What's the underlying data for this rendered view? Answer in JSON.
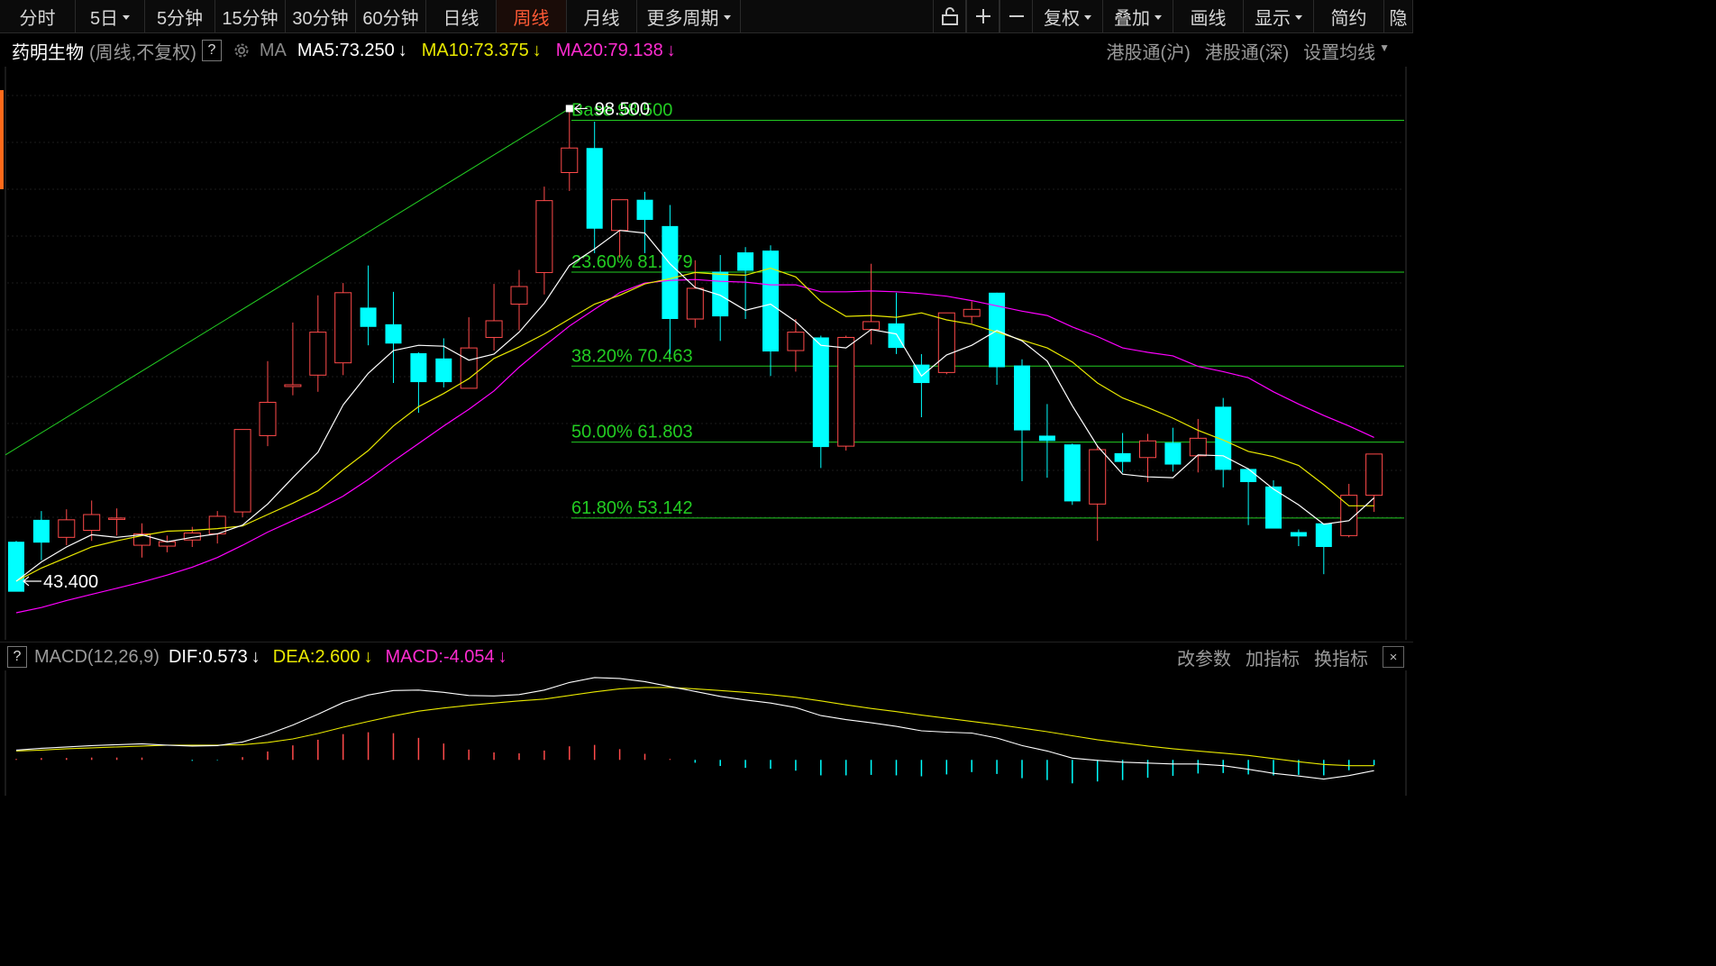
{
  "toolbar": {
    "periods": [
      {
        "label": "分时",
        "dropdown": false,
        "active": false
      },
      {
        "label": "5日",
        "dropdown": true,
        "active": false
      },
      {
        "label": "5分钟",
        "dropdown": false,
        "active": false
      },
      {
        "label": "15分钟",
        "dropdown": false,
        "active": false
      },
      {
        "label": "30分钟",
        "dropdown": false,
        "active": false
      },
      {
        "label": "60分钟",
        "dropdown": false,
        "active": false
      },
      {
        "label": "日线",
        "dropdown": false,
        "active": false
      },
      {
        "label": "周线",
        "dropdown": false,
        "active": true
      },
      {
        "label": "月线",
        "dropdown": false,
        "active": false
      },
      {
        "label": "更多周期",
        "dropdown": true,
        "active": false
      }
    ],
    "right_tools": [
      {
        "label": "复权",
        "dropdown": true
      },
      {
        "label": "叠加",
        "dropdown": true
      },
      {
        "label": "画线",
        "dropdown": false
      },
      {
        "label": "显示",
        "dropdown": true
      },
      {
        "label": "简约",
        "dropdown": false
      },
      {
        "label": "隐",
        "dropdown": false
      }
    ]
  },
  "info": {
    "stock_name": "药明生物",
    "mode": "(周线,不复权)",
    "help": "?",
    "ma_label": "MA",
    "ma5": "MA5:73.250",
    "ma10": "MA10:73.375",
    "ma20": "MA20:79.138",
    "right_links": [
      "港股通(沪)",
      "港股通(深)",
      "设置均线"
    ]
  },
  "colors": {
    "up": "#ff4a4a",
    "down": "#00ffff",
    "ma5": "#ffffff",
    "ma10": "#e8e800",
    "ma20": "#ff00ff",
    "fib": "#22cc22",
    "active_tab": "#ff5a36"
  },
  "chart_data": {
    "type": "candlestick",
    "period": "weekly",
    "ylim": [
      41,
      100.5
    ],
    "high_label": "98.500",
    "low_label": "43.400",
    "fib_levels": [
      {
        "label": "Base   98.500",
        "value": 98.5
      },
      {
        "label": "23.60% 81.179",
        "value": 81.179
      },
      {
        "label": "38.20% 70.463",
        "value": 70.463
      },
      {
        "label": "50.00% 61.803",
        "value": 61.803
      },
      {
        "label": "61.80% 53.142",
        "value": 53.142
      }
    ],
    "candles": [
      [
        49.1,
        43.4,
        49.2,
        44.6
      ],
      [
        51.6,
        49.0,
        52.6,
        47.0
      ],
      [
        49.6,
        51.6,
        52.8,
        48.7
      ],
      [
        50.4,
        52.2,
        53.8,
        49.2
      ],
      [
        51.7,
        51.8,
        52.9,
        49.8
      ],
      [
        48.7,
        50.0,
        51.2,
        47.3
      ],
      [
        48.6,
        49.1,
        49.8,
        47.9
      ],
      [
        49.3,
        50.1,
        50.8,
        48.5
      ],
      [
        50.0,
        52.0,
        52.6,
        48.9
      ],
      [
        52.5,
        61.9,
        61.9,
        51.9
      ],
      [
        61.2,
        65.0,
        69.7,
        60.0
      ],
      [
        66.8,
        67.0,
        74.1,
        65.8
      ],
      [
        68.1,
        73.0,
        77.2,
        66.2
      ],
      [
        69.5,
        77.5,
        78.6,
        68.1
      ],
      [
        75.8,
        73.6,
        80.6,
        71.5
      ],
      [
        73.9,
        71.7,
        77.6,
        67.2
      ],
      [
        70.6,
        67.3,
        70.7,
        63.8
      ],
      [
        70.0,
        67.3,
        72.3,
        66.7
      ],
      [
        66.6,
        71.2,
        74.7,
        66.6
      ],
      [
        72.4,
        74.3,
        78.5,
        70.9
      ],
      [
        76.2,
        78.2,
        80.1,
        73.2
      ],
      [
        79.8,
        88.0,
        89.6,
        77.3
      ],
      [
        91.2,
        94.0,
        98.5,
        89.1
      ],
      [
        94.0,
        84.8,
        97.0,
        82.0
      ],
      [
        84.6,
        88.1,
        88.1,
        81.5
      ],
      [
        88.1,
        85.8,
        89.0,
        82.0
      ],
      [
        85.1,
        74.5,
        87.5,
        70.5
      ],
      [
        74.5,
        78.0,
        81.2,
        73.5
      ],
      [
        79.9,
        74.8,
        81.8,
        72.0
      ],
      [
        82.1,
        80.0,
        82.7,
        74.5
      ],
      [
        82.3,
        70.8,
        82.9,
        68.0
      ],
      [
        70.9,
        73.0,
        74.5,
        68.5
      ],
      [
        72.4,
        59.9,
        72.6,
        57.5
      ],
      [
        60.0,
        72.4,
        72.6,
        59.5
      ],
      [
        73.3,
        74.2,
        80.8,
        71.6
      ],
      [
        74.0,
        71.2,
        77.5,
        70.5
      ],
      [
        69.3,
        67.2,
        70.5,
        63.3
      ],
      [
        68.4,
        75.2,
        75.2,
        68.2
      ],
      [
        74.8,
        75.6,
        76.5,
        74.0
      ],
      [
        77.5,
        69.0,
        77.5,
        67.0
      ],
      [
        69.2,
        61.8,
        69.9,
        56.0
      ],
      [
        61.2,
        60.6,
        64.8,
        56.4
      ],
      [
        60.2,
        53.7,
        60.3,
        53.3
      ],
      [
        53.4,
        59.6,
        60.1,
        49.2
      ],
      [
        59.2,
        58.2,
        61.5,
        57.0
      ],
      [
        58.7,
        60.6,
        61.4,
        55.9
      ],
      [
        60.4,
        57.9,
        62.1,
        57.1
      ],
      [
        58.9,
        60.9,
        63.1,
        57.0
      ],
      [
        64.5,
        57.3,
        65.5,
        55.3
      ],
      [
        57.4,
        55.9,
        57.5,
        51.0
      ],
      [
        55.4,
        50.6,
        56.1,
        50.7
      ],
      [
        50.2,
        49.7,
        50.5,
        48.6
      ],
      [
        51.2,
        48.5,
        51.1,
        45.4
      ],
      [
        49.8,
        54.4,
        55.7,
        49.6
      ],
      [
        54.4,
        59.1,
        59.1,
        52.5
      ]
    ],
    "ma5": [
      44.6,
      46.8,
      48.5,
      49.9,
      49.6,
      49.9,
      49.1,
      49.6,
      50.0,
      51.0,
      53.4,
      56.4,
      59.3,
      64.7,
      68.3,
      70.9,
      71.5,
      71.4,
      69.8,
      70.5,
      73.0,
      76.3,
      80.6,
      82.5,
      84.6,
      84.3,
      80.8,
      78.1,
      77.2,
      75.5,
      76.2,
      74.2,
      71.5,
      71.2,
      73.3,
      72.8,
      68.0,
      70.4,
      71.5,
      73.2,
      72.0,
      69.7,
      64.6,
      60.0,
      56.8,
      56.5,
      56.4,
      59.0,
      58.9,
      57.4,
      55.1,
      53.3,
      51.1,
      51.5,
      54.1
    ],
    "ma10": [
      44.6,
      46.1,
      47.3,
      48.5,
      49.2,
      49.8,
      50.3,
      50.4,
      50.6,
      50.9,
      52.2,
      53.5,
      54.9,
      57.3,
      59.5,
      62.3,
      64.5,
      66.0,
      67.7,
      70.0,
      71.3,
      72.8,
      74.5,
      76.2,
      77.2,
      78.5,
      79.1,
      79.8,
      79.6,
      79.5,
      80.3,
      79.3,
      76.5,
      74.8,
      74.9,
      74.7,
      75.2,
      74.4,
      73.9,
      73.0,
      72.1,
      71.2,
      69.6,
      67.2,
      65.5,
      64.4,
      63.2,
      61.8,
      60.7,
      59.4,
      58.8,
      57.8,
      55.6,
      53.2,
      53.2
    ],
    "ma20": [
      41.0,
      41.6,
      42.4,
      43.1,
      43.8,
      44.5,
      45.3,
      46.2,
      47.3,
      48.7,
      50.2,
      51.5,
      52.8,
      54.3,
      56.2,
      58.3,
      60.3,
      62.3,
      64.2,
      66.3,
      69.0,
      71.4,
      73.7,
      75.6,
      77.5,
      78.6,
      78.9,
      79.0,
      78.8,
      78.7,
      78.4,
      78.4,
      77.6,
      77.6,
      77.7,
      77.6,
      77.4,
      77.1,
      76.6,
      76.0,
      75.4,
      74.9,
      73.6,
      72.5,
      71.2,
      70.7,
      70.3,
      69.1,
      68.5,
      67.8,
      66.2,
      64.8,
      63.5,
      62.3,
      61.0
    ]
  },
  "macd": {
    "help": "?",
    "title": "MACD(12,26,9)",
    "dif": "DIF:0.573",
    "dea": "DEA:2.600",
    "macd_value": "MACD:-4.054",
    "right_links": [
      "改参数",
      "加指标",
      "换指标"
    ],
    "close": "×",
    "dif_series": [
      2.2,
      2.6,
      2.9,
      3.2,
      3.4,
      3.6,
      3.3,
      3.1,
      3.2,
      4.0,
      5.7,
      7.8,
      10.2,
      12.8,
      14.5,
      15.5,
      15.6,
      15.1,
      14.4,
      14.3,
      14.6,
      15.6,
      17.3,
      18.4,
      18.2,
      17.5,
      16.4,
      15.3,
      14.2,
      13.4,
      12.7,
      11.7,
      9.9,
      9.0,
      8.3,
      7.5,
      6.5,
      6.2,
      6.0,
      4.9,
      3.2,
      2.0,
      0.4,
      -0.1,
      -0.5,
      -0.7,
      -0.9,
      -0.9,
      -1.3,
      -2.1,
      -3.0,
      -3.6,
      -4.3,
      -3.5,
      -2.4
    ],
    "dea_series": [
      2.0,
      2.2,
      2.5,
      2.7,
      2.9,
      3.1,
      3.3,
      3.3,
      3.3,
      3.4,
      3.9,
      4.7,
      5.9,
      7.3,
      8.6,
      9.8,
      10.9,
      11.6,
      12.2,
      12.7,
      13.2,
      13.6,
      14.4,
      15.2,
      15.9,
      16.2,
      16.2,
      15.9,
      15.5,
      15.1,
      14.6,
      14.0,
      13.2,
      12.3,
      11.5,
      10.8,
      10.0,
      9.3,
      8.6,
      7.9,
      7.1,
      6.3,
      5.4,
      4.5,
      3.8,
      3.1,
      2.5,
      2.0,
      1.5,
      1.0,
      0.3,
      -0.4,
      -1.0,
      -1.3,
      -1.3
    ],
    "hist": [
      0.4,
      0.8,
      0.8,
      1.0,
      1.0,
      1.0,
      0.0,
      -0.4,
      -0.2,
      1.2,
      3.6,
      6.2,
      8.6,
      11.0,
      11.8,
      11.4,
      9.4,
      7.0,
      4.4,
      3.2,
      2.8,
      4.0,
      5.8,
      6.4,
      4.6,
      2.6,
      0.4,
      -1.2,
      -2.6,
      -3.4,
      -3.8,
      -4.6,
      -6.6,
      -6.6,
      -6.4,
      -6.6,
      -7.0,
      -6.2,
      -5.2,
      -6.0,
      -7.8,
      -8.6,
      -10.0,
      -9.2,
      -8.6,
      -7.6,
      -6.8,
      -5.8,
      -5.6,
      -6.2,
      -6.6,
      -6.4,
      -6.6,
      -4.4,
      -2.2
    ]
  }
}
